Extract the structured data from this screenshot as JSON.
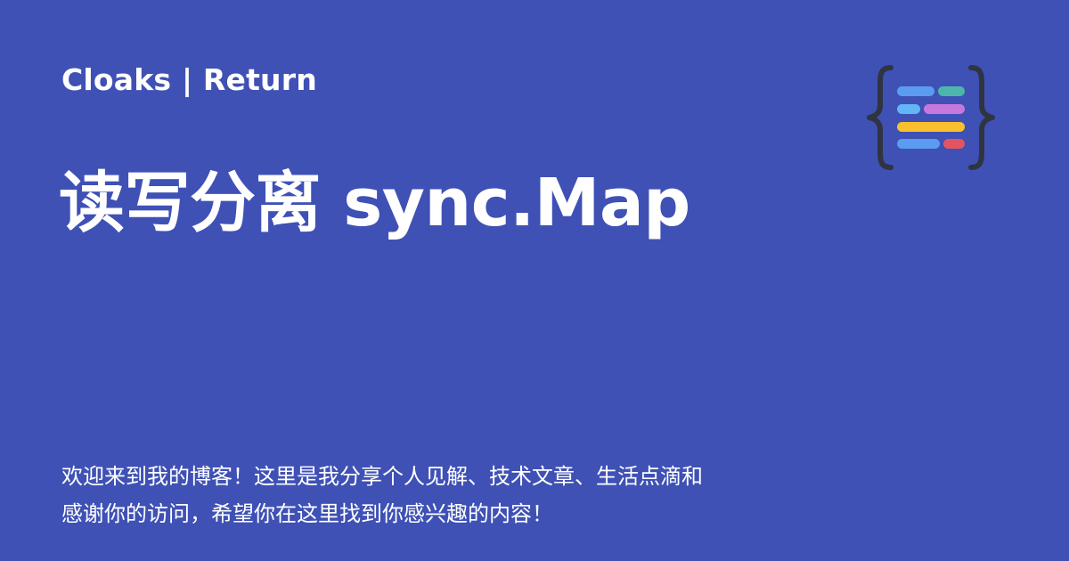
{
  "header": {
    "site_name": "Cloaks | Return"
  },
  "article": {
    "title": "读写分离 sync.Map"
  },
  "description": {
    "line1": "欢迎来到我的博客！这里是我分享个人见解、技术文章、生活点滴和",
    "line2": "感谢你的访问，希望你在这里找到你感兴趣的内容！"
  },
  "logo": {
    "icon": "code-braces-icon",
    "colors": {
      "brace": "#2F3440",
      "blue": "#5B9CF0",
      "teal": "#4DB6AC",
      "light_blue": "#64B5F6",
      "violet": "#C678DD",
      "yellow": "#FBC02D",
      "red": "#E05561"
    }
  },
  "theme": {
    "background": "#3F51B5",
    "text": "#FFFFFF"
  }
}
